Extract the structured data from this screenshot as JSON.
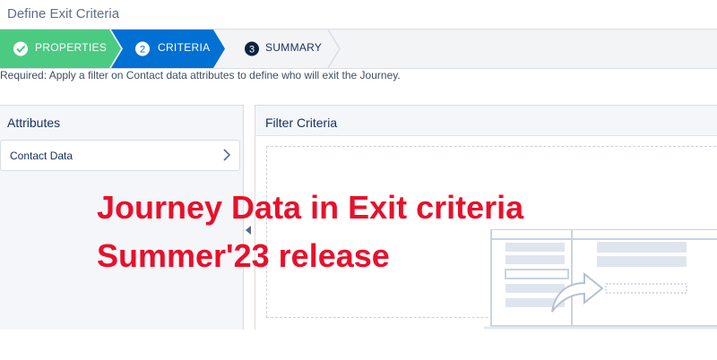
{
  "window": {
    "title": "Define Exit Criteria"
  },
  "steps": [
    {
      "number": "",
      "label": "PROPERTIES",
      "state": "complete"
    },
    {
      "number": "2",
      "label": "CRITERIA",
      "state": "active"
    },
    {
      "number": "3",
      "label": "SUMMARY",
      "state": "upcoming"
    }
  ],
  "instruction": "Required: Apply a filter on Contact data attributes to define who will exit the Journey.",
  "attributes": {
    "header": "Attributes",
    "items": [
      {
        "label": "Contact Data",
        "icon": "chevron-right-icon"
      }
    ]
  },
  "filter": {
    "header": "Filter Criteria"
  },
  "overlay": {
    "line1": "Journey Data in Exit criteria",
    "line2": "Summer'23 release"
  },
  "colors": {
    "complete": "#4bca81",
    "active": "#0070d2",
    "upcoming": "#f3f4f6",
    "overlay": "#e8102b"
  }
}
